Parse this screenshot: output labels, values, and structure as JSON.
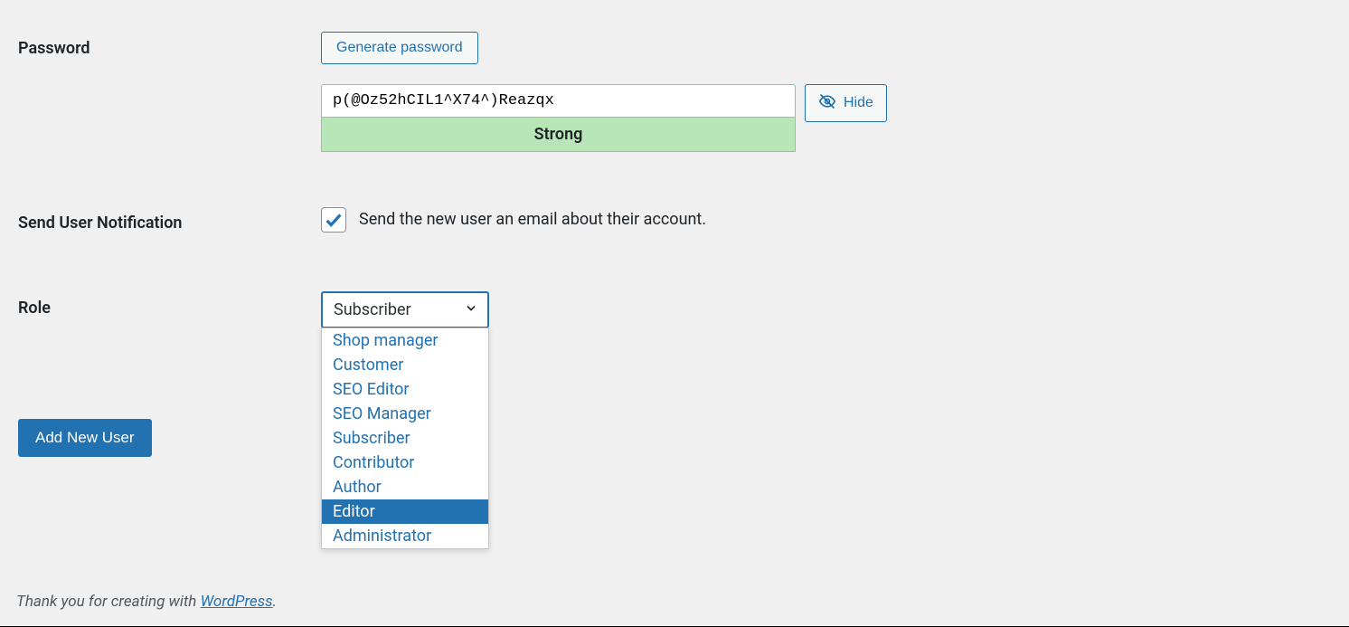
{
  "password": {
    "label": "Password",
    "generate_button": "Generate password",
    "value": "p(@Oz52hCIL1^X74^)Reazqx",
    "strength": "Strong",
    "hide_button": "Hide"
  },
  "notification": {
    "label": "Send User Notification",
    "checkbox_label": "Send the new user an email about their account.",
    "checked": true
  },
  "role": {
    "label": "Role",
    "selected": "Subscriber",
    "options": [
      "Shop manager",
      "Customer",
      "SEO Editor",
      "SEO Manager",
      "Subscriber",
      "Contributor",
      "Author",
      "Editor",
      "Administrator"
    ],
    "highlighted": "Editor"
  },
  "submit_button": "Add New User",
  "footer": {
    "prefix": "Thank you for creating with ",
    "link_text": "WordPress",
    "suffix": "."
  }
}
